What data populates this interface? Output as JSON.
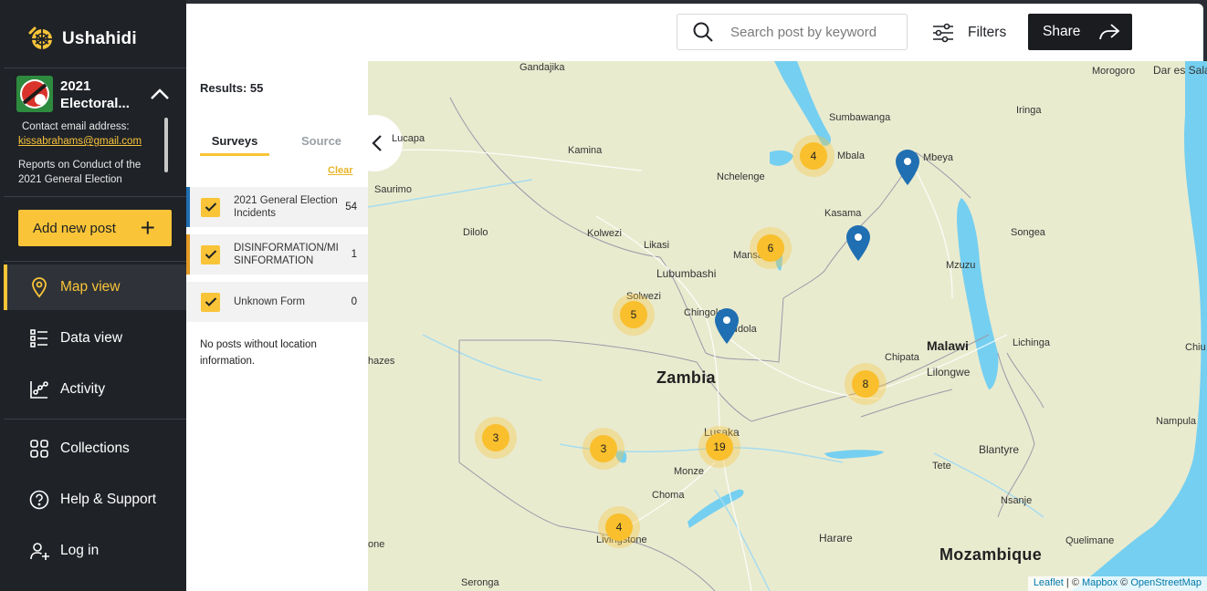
{
  "app": {
    "name": "Ushahidi"
  },
  "deployment": {
    "title": "2021 Electoral...",
    "contact_label": "Contact email address:",
    "email": "kissabrahams@gmail.com",
    "description": "Reports on Conduct of the 2021 General Election"
  },
  "add_post": {
    "label": "Add new post",
    "icon": "plus-icon"
  },
  "nav": [
    {
      "label": "Map view",
      "icon": "location-pin-icon",
      "active": true
    },
    {
      "label": "Data view",
      "icon": "list-icon",
      "active": false
    },
    {
      "label": "Activity",
      "icon": "activity-chart-icon",
      "active": false
    },
    {
      "label": "Collections",
      "icon": "grid-icon",
      "active": false
    },
    {
      "label": "Help & Support",
      "icon": "help-icon",
      "active": false
    },
    {
      "label": "Log in",
      "icon": "user-add-icon",
      "active": false
    }
  ],
  "header": {
    "search_placeholder": "Search post by keyword",
    "filters_label": "Filters",
    "share_label": "Share"
  },
  "panel": {
    "results": "Results: 55",
    "tabs": [
      "Surveys",
      "Source"
    ],
    "clear_label": "Clear",
    "surveys": [
      {
        "name": "2021 General Election Incidents",
        "count": "54",
        "color": "#1f6fb2",
        "checked": true
      },
      {
        "name": "DISINFORMATION/MISINFORMATION",
        "count": "1",
        "color": "#e39a25",
        "checked": true
      },
      {
        "name": "Unknown Form",
        "count": "0",
        "color": "",
        "checked": true
      }
    ],
    "no_location": "No posts without location information."
  },
  "map": {
    "places": [
      "Gandajika",
      "Lucapa",
      "Kamina",
      "Saurimo",
      "Dilolo",
      "Kolwezi",
      "Likasi",
      "Lubumbashi",
      "Solwezi",
      "Chingola",
      "Ndola",
      "Nchelenge",
      "Mansa",
      "Kasama",
      "Mbala",
      "Sumbawanga",
      "Mbeya",
      "Morogoro",
      "Dar es Salaam",
      "Iringa",
      "Songea",
      "Mzuzu",
      "Chipata",
      "Lilongwe",
      "Lichinga",
      "Malawi",
      "Zambia",
      "Lusaka",
      "Monze",
      "Choma",
      "Livingstone",
      "Harare",
      "Tete",
      "Blantyre",
      "Nsanje",
      "Nampula",
      "Quelimane",
      "Mozambique",
      "Seronga",
      "Chiu",
      "hazes",
      "one"
    ],
    "clusters": [
      "4",
      "6",
      "5",
      "8",
      "3",
      "3",
      "19",
      "4"
    ],
    "attribution": {
      "leaflet": "Leaflet",
      "mapbox": "Mapbox",
      "osm": "OpenStreetMap",
      "sep1": " | © ",
      "sep2": " © "
    }
  }
}
